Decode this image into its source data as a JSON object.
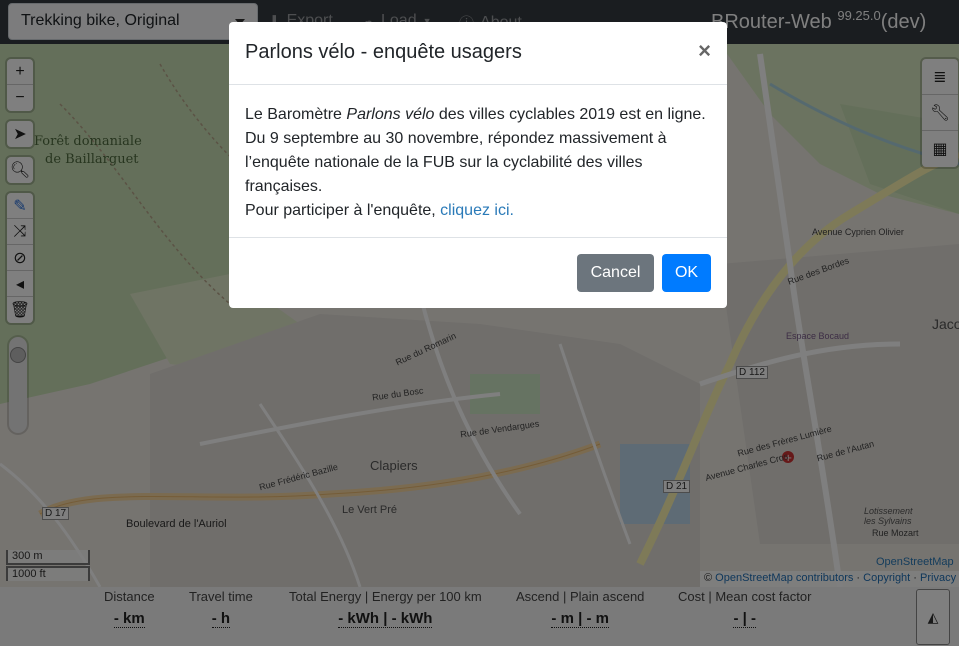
{
  "navbar": {
    "profile_value": "Trekking bike, Original",
    "export_label": "Export",
    "load_label": "Load",
    "about_label": "About",
    "brand": "BRouter-Web",
    "version": "99.25.0",
    "dev": "(dev)"
  },
  "map_labels": [
    {
      "text": "Forêt domaniale",
      "id": "foret"
    },
    {
      "text": "de Baillarguet",
      "id": "baillarguet"
    },
    {
      "text": "Clapiers",
      "id": "clapiers"
    },
    {
      "text": "Le Vert Pré",
      "id": "vertpre"
    },
    {
      "text": "Boulevard de l'Auriol",
      "id": "boulevard"
    },
    {
      "text": "D 17",
      "id": "d17"
    },
    {
      "text": "D 112",
      "id": "d112"
    },
    {
      "text": "D 21",
      "id": "d21"
    },
    {
      "text": "Rue de Vendargues",
      "id": "vendargues"
    },
    {
      "text": "Rue du Bosc",
      "id": "bosc"
    },
    {
      "text": "Rue du Romarin",
      "id": "romarin"
    },
    {
      "text": "Rue Frédéric Bazille",
      "id": "bazille"
    },
    {
      "text": "Avenue Charles Cros",
      "id": "cros"
    },
    {
      "text": "Rue des Frères Lumière",
      "id": "lumiere"
    },
    {
      "text": "Rue de l'Autan",
      "id": "autan"
    },
    {
      "text": "Espace Bocaud",
      "id": "bocaud"
    },
    {
      "text": "Avenue Cyprien Olivier",
      "id": "olivier"
    },
    {
      "text": "Rue des Bordes",
      "id": "bordes"
    },
    {
      "text": "Rue Mozart",
      "id": "mozart"
    },
    {
      "text": "Lotissement les Sylvains",
      "id": "sylvains"
    },
    {
      "text": "Jacou",
      "id": "jacou"
    }
  ],
  "scale": {
    "metric": "300 m",
    "imperial": "1000 ft"
  },
  "attribution": {
    "osm_label": "OpenStreetMap",
    "copyright_prefix": "©",
    "contributors": "OpenStreetMap contributors",
    "copyright": "Copyright",
    "privacy": "Privacy",
    "sep": "·"
  },
  "stats": {
    "distance": {
      "label": "Distance",
      "value": "- km"
    },
    "travel_time": {
      "label": "Travel time",
      "value": "- h"
    },
    "energy": {
      "label": "Total Energy | Energy per 100 km",
      "value": "- kWh | - kWh"
    },
    "ascend": {
      "label": "Ascend | Plain ascend",
      "value": "- m | - m"
    },
    "cost": {
      "label": "Cost | Mean cost factor",
      "value": "- | -"
    }
  },
  "modal": {
    "title": "Parlons vélo - enquête usagers",
    "close": "×",
    "body_prefix": "Le Baromètre ",
    "body_italic": "Parlons vélo",
    "body_suffix": " des villes cyclables 2019 est en ligne. Du 9 septembre au 30 novembre, répondez massivement à l’enquête nationale de la FUB sur la cyclabilité des villes françaises.",
    "participate_prefix": "Pour participer à l'enquête, ",
    "participate_link": "cliquez ici.",
    "cancel_label": "Cancel",
    "ok_label": "OK"
  },
  "colors": {
    "navbar": "#343a40",
    "primary": "#007bff",
    "secondary": "#6c757d",
    "forest": "#c8dfb4",
    "residential": "#e0dcd6"
  }
}
